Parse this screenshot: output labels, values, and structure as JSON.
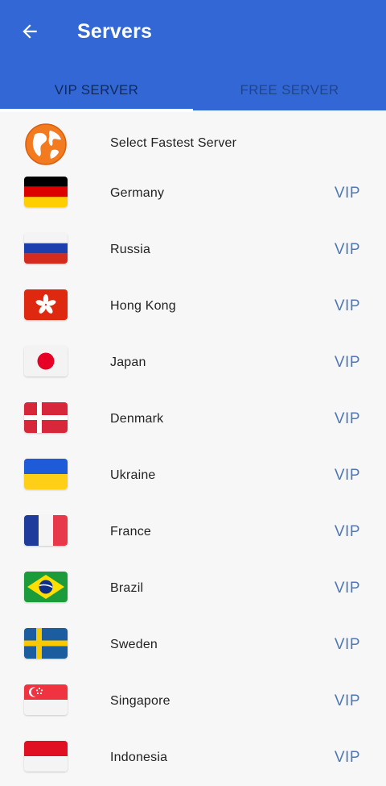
{
  "appbar": {
    "title": "Servers",
    "back_icon": "arrow-left-icon",
    "color": "#3267d5"
  },
  "tabs": [
    {
      "label": "VIP SERVER",
      "active": true
    },
    {
      "label": "FREE SERVER",
      "active": false
    }
  ],
  "fastest": {
    "label": "Select Fastest Server",
    "icon": "globe-icon"
  },
  "servers": [
    {
      "name": "Germany",
      "badge": "VIP",
      "flag": "germany-flag-icon"
    },
    {
      "name": "Russia",
      "badge": "VIP",
      "flag": "russia-flag-icon"
    },
    {
      "name": "Hong Kong",
      "badge": "VIP",
      "flag": "hong-kong-flag-icon"
    },
    {
      "name": "Japan",
      "badge": "VIP",
      "flag": "japan-flag-icon"
    },
    {
      "name": "Denmark",
      "badge": "VIP",
      "flag": "denmark-flag-icon"
    },
    {
      "name": "Ukraine",
      "badge": "VIP",
      "flag": "ukraine-flag-icon"
    },
    {
      "name": "France",
      "badge": "VIP",
      "flag": "france-flag-icon"
    },
    {
      "name": "Brazil",
      "badge": "VIP",
      "flag": "brazil-flag-icon"
    },
    {
      "name": "Sweden",
      "badge": "VIP",
      "flag": "sweden-flag-icon"
    },
    {
      "name": "Singapore",
      "badge": "VIP",
      "flag": "singapore-flag-icon"
    },
    {
      "name": "Indonesia",
      "badge": "VIP",
      "flag": "indonesia-flag-icon"
    }
  ]
}
